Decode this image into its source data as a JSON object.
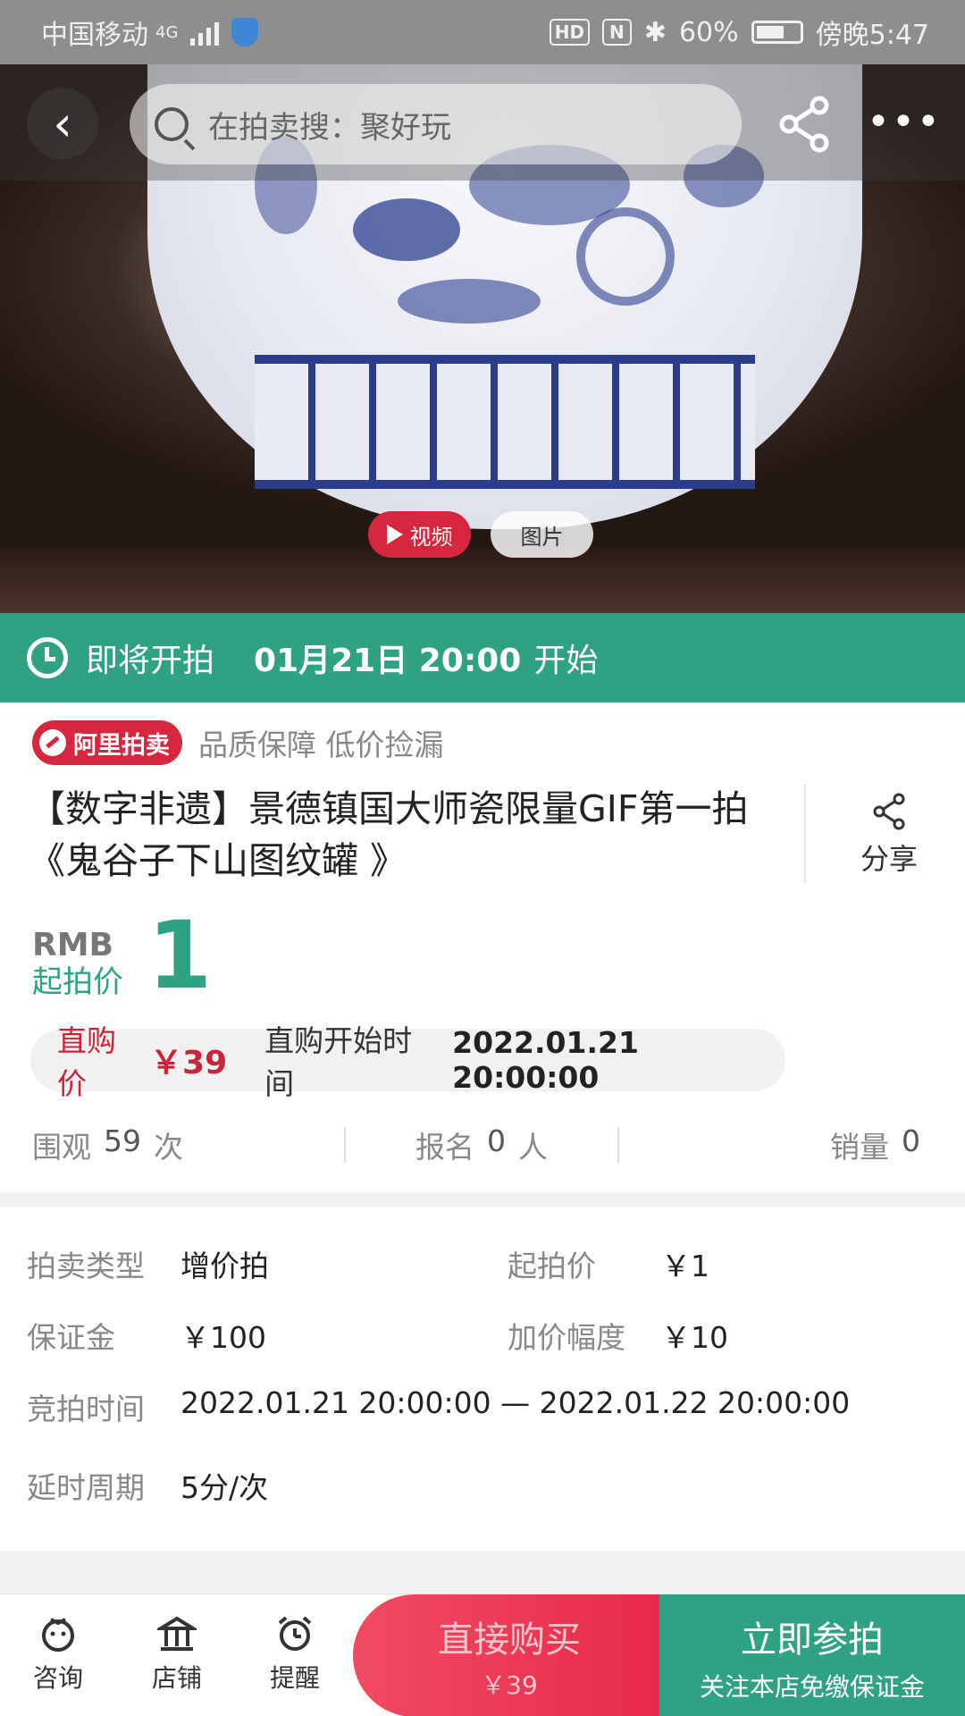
{
  "status_bar": {
    "carrier": "中国移动",
    "network": "4G",
    "hd": "HD",
    "nfc": "N",
    "bluetooth": "✱",
    "battery": "60%",
    "time": "傍晚5:47"
  },
  "top_nav": {
    "back_glyph": "‹",
    "search_placeholder": "在拍卖搜：聚好玩",
    "more_glyph": "•••"
  },
  "media": {
    "video_label": "视频",
    "image_label": "图片"
  },
  "countdown": {
    "status": "即将开拍",
    "time": "01月21日 20:00",
    "suffix": "开始"
  },
  "product": {
    "badge": "阿里拍卖",
    "slogan": "品质保障 低价捡漏",
    "title": "【数字非遗】景德镇国大师瓷限量GIF第一拍《鬼谷子下山图纹罐 》",
    "share_label": "分享",
    "currency": "RMB",
    "start_price_label": "起拍价",
    "start_price": "1",
    "buy_price_label": "直购价",
    "buy_price": "￥39",
    "buy_start_label": "直购开始时间",
    "buy_start_time": "2022.01.21 20:00:00"
  },
  "stats": {
    "views_label": "围观",
    "views": "59",
    "views_unit": "次",
    "signup_label": "报名",
    "signup": "0",
    "signup_unit": "人",
    "sales_label": "销量",
    "sales": "0"
  },
  "details": {
    "auction_type_label": "拍卖类型",
    "auction_type": "增价拍",
    "start_price_label": "起拍价",
    "start_price": "￥1",
    "deposit_label": "保证金",
    "deposit": "￥100",
    "increment_label": "加价幅度",
    "increment": "￥10",
    "bid_time_label": "竞拍时间",
    "bid_time": "2022.01.21 20:00:00 — 2022.01.22 20:00:00",
    "delay_label": "延时周期",
    "delay": "5分/次"
  },
  "bottom_bar": {
    "consult": "咨询",
    "shop": "店铺",
    "remind": "提醒",
    "buy_now": "直接购买",
    "buy_now_price": "￥39",
    "join_bid": "立即参拍",
    "join_bid_sub": "关注本店免缴保证金"
  },
  "colors": {
    "accent_green": "#2ea283",
    "accent_red": "#d7263f"
  }
}
